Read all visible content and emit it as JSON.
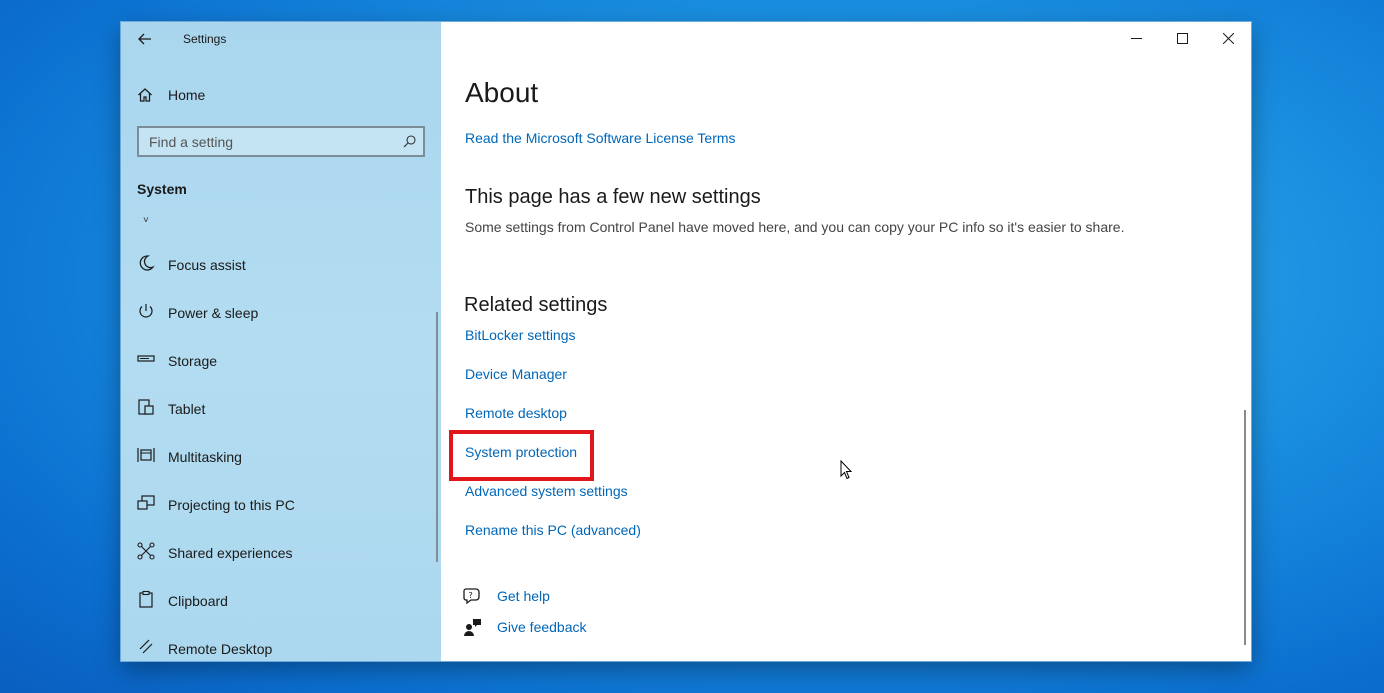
{
  "window": {
    "app_title": "Settings",
    "home_label": "Home",
    "search_placeholder": "Find a setting",
    "section_title": "System",
    "section_marker": "˅"
  },
  "sidebar": {
    "items": [
      {
        "label": "Focus assist",
        "icon": "moon-icon"
      },
      {
        "label": "Power & sleep",
        "icon": "power-icon"
      },
      {
        "label": "Storage",
        "icon": "storage-icon"
      },
      {
        "label": "Tablet",
        "icon": "tablet-icon"
      },
      {
        "label": "Multitasking",
        "icon": "multitasking-icon"
      },
      {
        "label": "Projecting to this PC",
        "icon": "projector-icon"
      },
      {
        "label": "Shared experiences",
        "icon": "share-icon"
      },
      {
        "label": "Clipboard",
        "icon": "clipboard-icon"
      },
      {
        "label": "Remote Desktop",
        "icon": "remote-desktop-icon"
      }
    ]
  },
  "main": {
    "title": "About",
    "license_link": "Read the Microsoft Software License Terms",
    "new_settings_heading": "This page has a few new settings",
    "new_settings_desc": "Some settings from Control Panel have moved here, and you can copy your PC info so it's easier to share.",
    "related_heading": "Related settings",
    "related_links": [
      "BitLocker settings",
      "Device Manager",
      "Remote desktop",
      "System protection",
      "Advanced system settings",
      "Rename this PC (advanced)"
    ],
    "get_help": "Get help",
    "give_feedback": "Give feedback"
  },
  "colors": {
    "link": "#0067b8",
    "highlight": "#e0161b",
    "sidebar_bg": "#b3dcf1"
  }
}
